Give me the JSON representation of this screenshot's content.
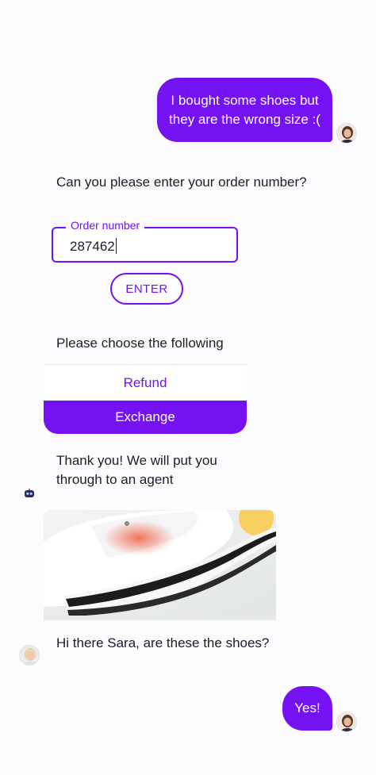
{
  "messages": {
    "user_1": {
      "line_1": "I bought some shoes but",
      "line_2": "they are the wrong size :("
    },
    "bot_order_prompt": "Can you please enter your order number?",
    "order_field": {
      "label": "Order number",
      "value": "287462"
    },
    "enter_button": "ENTER",
    "choice_prompt": "Please choose the following",
    "choices": {
      "refund": "Refund",
      "exchange": "Exchange"
    },
    "bot_agent": {
      "line_1": "Thank you! We will put you",
      "line_2": "through to an agent"
    },
    "agent_question": "Hi there Sara, are these the shoes?",
    "user_2": "Yes!"
  },
  "colors": {
    "accent": "#7412f2",
    "background": "#fcfbfd",
    "text": "#1f1b2d"
  },
  "icons": {
    "bot": "robot-icon",
    "user_avatar": "avatar-user",
    "agent_avatar": "avatar-agent"
  }
}
